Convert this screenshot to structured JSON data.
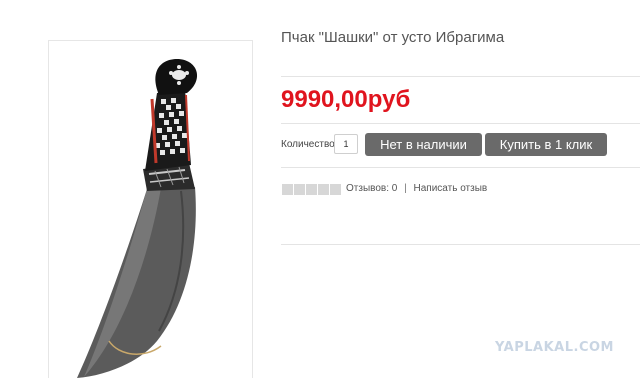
{
  "product": {
    "title": "Пчак \"Шашки\" от усто Ибрагима",
    "price": "9990,00руб",
    "image_alt": "knife-product-image"
  },
  "purchase": {
    "quantity_label": "Количество:",
    "quantity_value": "1",
    "out_of_stock_label": "Нет в наличии",
    "buy_one_click_label": "Купить в 1 клик"
  },
  "review": {
    "rating_stars": 5,
    "rating_value": 0,
    "reviews_count_text": "Отзывов: 0",
    "separator": "|",
    "write_review_label": "Написать отзыв"
  },
  "watermark": {
    "text": "YAPLAKAL.COM"
  },
  "colors": {
    "price": "#e0141e",
    "button_bg": "#6a6a6a",
    "star_empty": "#d7d7d7",
    "watermark": "#c9d5e3"
  }
}
